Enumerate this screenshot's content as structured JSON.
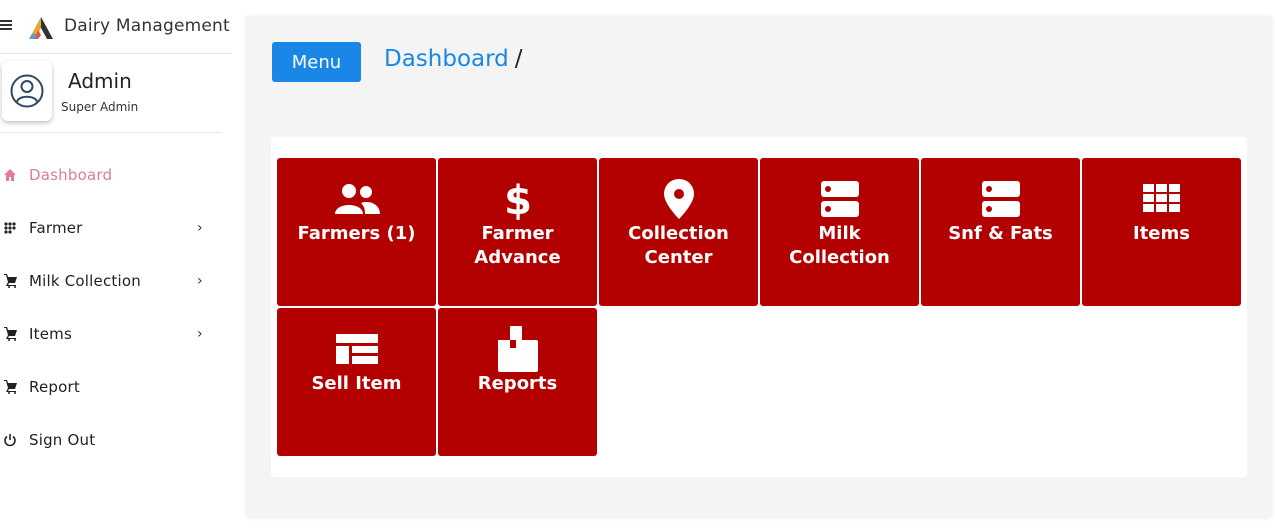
{
  "brand": {
    "title": "Dairy Management"
  },
  "profile": {
    "name": "Admin",
    "role": "Super Admin"
  },
  "nav": {
    "items": [
      {
        "label": "Dashboard"
      },
      {
        "label": "Farmer",
        "chevron": "›"
      },
      {
        "label": "Milk Collection",
        "chevron": "›"
      },
      {
        "label": "Items",
        "chevron": "›"
      },
      {
        "label": "Report"
      },
      {
        "label": "Sign Out"
      }
    ]
  },
  "header": {
    "menu_label": "Menu",
    "breadcrumb": "Dashboard",
    "breadcrumb_sep": "/"
  },
  "tiles": [
    {
      "label": "Farmers (1)",
      "icon": "users-icon"
    },
    {
      "label": "Farmer Advance",
      "icon": "dollar-icon"
    },
    {
      "label": "Collection Center",
      "icon": "map-marker-icon"
    },
    {
      "label": "Milk Collection",
      "icon": "server-icon"
    },
    {
      "label": "Snf & Fats",
      "icon": "server-icon"
    },
    {
      "label": "Items",
      "icon": "grid-icon"
    },
    {
      "label": "Sell Item",
      "icon": "table-icon"
    },
    {
      "label": "Reports",
      "icon": "mailbox-icon"
    }
  ],
  "colors": {
    "accent": "#1a87e6",
    "tile": "#b30000",
    "active_nav": "#e07aa0"
  }
}
